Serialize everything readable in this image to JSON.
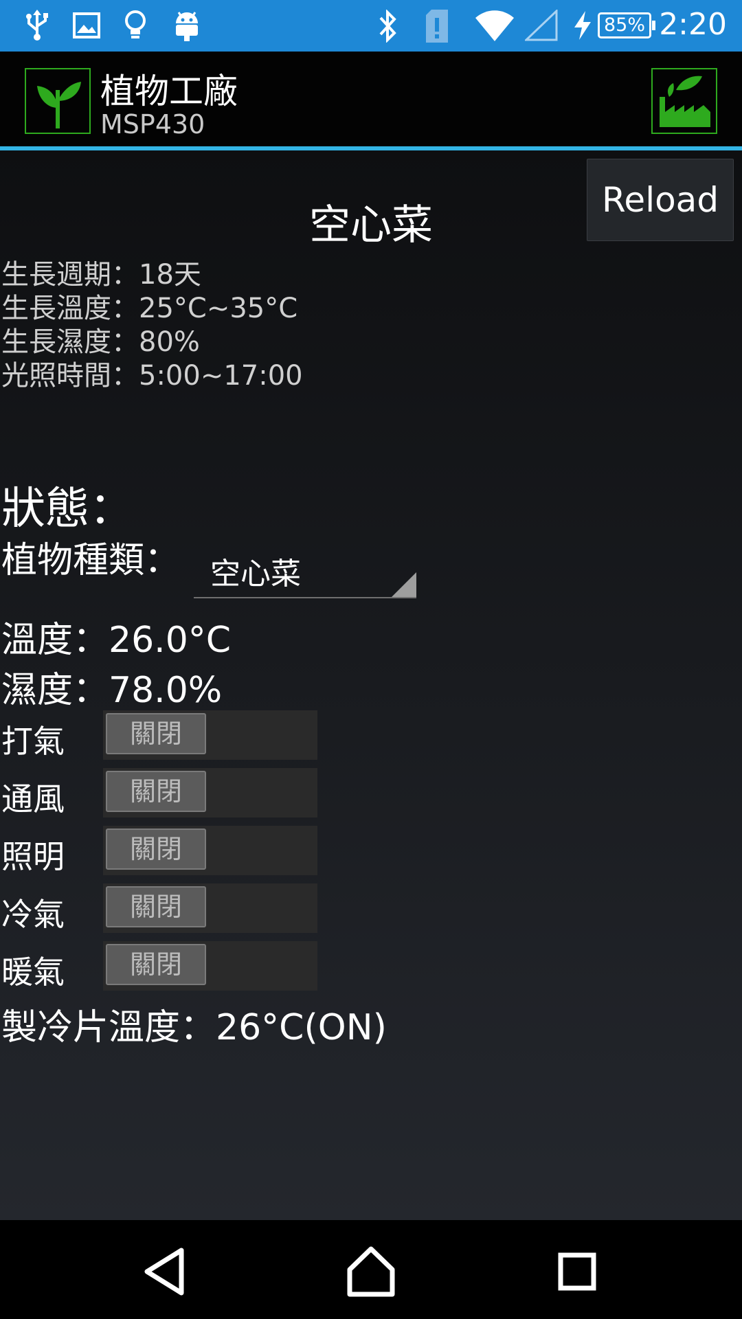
{
  "status_bar": {
    "time": "2:20",
    "battery": "85%",
    "left_icons": [
      "usb-icon",
      "image-icon",
      "bulb-icon",
      "android-icon"
    ],
    "right_icons": [
      "bluetooth-icon",
      "sim-alert-icon",
      "wifi-icon",
      "signal-icon",
      "charging-icon"
    ]
  },
  "action_bar": {
    "title": "植物工廠",
    "subtitle": "MSP430"
  },
  "content": {
    "reload_label": "Reload",
    "plant_title": "空心菜",
    "info": {
      "growth_cycle": "生長週期：18天",
      "growth_temp": "生長溫度：25°C~35°C",
      "growth_humidity": "生長濕度：80%",
      "light_time": "光照時間：5:00~17:00"
    },
    "status_heading": "狀態：",
    "plant_type_label": "植物種類：",
    "plant_type_selected": "空心菜",
    "temperature": "溫度：26.0°C",
    "humidity": "濕度：78.0%",
    "controls": [
      {
        "label": "打氣",
        "state": "關閉"
      },
      {
        "label": "通風",
        "state": "關閉"
      },
      {
        "label": "照明",
        "state": "關閉"
      },
      {
        "label": "冷氣",
        "state": "關閉"
      },
      {
        "label": "暖氣",
        "state": "關閉"
      }
    ],
    "cooler_temp": "製冷片溫度：26°C(ON)"
  },
  "colors": {
    "status_bar": "#1E88D6",
    "accent_line": "#33B5E5",
    "icon_green": "#2eaa1e"
  }
}
